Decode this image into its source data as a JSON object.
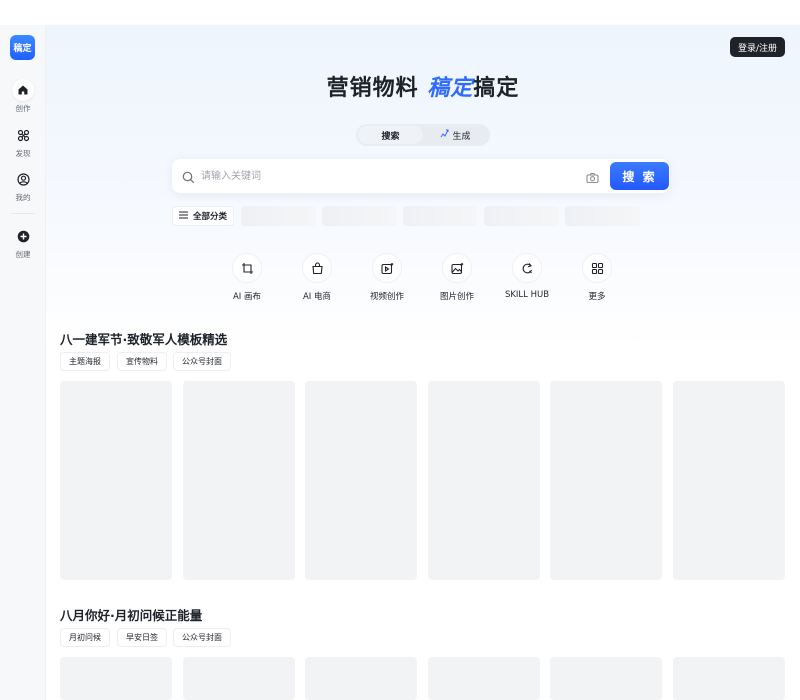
{
  "sidebar": {
    "logo_text": "稿定",
    "items": [
      {
        "label": "创作",
        "icon": "home-icon",
        "active": true
      },
      {
        "label": "发现",
        "icon": "discover-icon",
        "active": false
      },
      {
        "label": "我的",
        "icon": "user-icon",
        "active": false
      },
      {
        "label": "创建",
        "icon": "plus-circle-icon",
        "active": false
      }
    ]
  },
  "header": {
    "login_label": "登录/注册"
  },
  "hero": {
    "text_before": "营销物料 ",
    "text_accent": "稿定",
    "text_after": "搞定"
  },
  "mode_tabs": [
    {
      "label": "搜索",
      "active": true
    },
    {
      "label": "生成",
      "active": false
    }
  ],
  "search": {
    "placeholder": "请输入关键词",
    "button_label": "搜 索"
  },
  "categories": {
    "all_label": "全部分类"
  },
  "tools": [
    {
      "label": "AI 画布",
      "icon": "canvas-crop-icon"
    },
    {
      "label": "AI 电商",
      "icon": "shopping-bag-icon"
    },
    {
      "label": "视频创作",
      "icon": "video-sparkle-icon"
    },
    {
      "label": "图片创作",
      "icon": "image-sparkle-icon"
    },
    {
      "label": "SKILL HUB",
      "icon": "skill-hub-icon"
    },
    {
      "label": "更多",
      "icon": "grid-icon"
    }
  ],
  "sections": [
    {
      "title": "八一建军节·致敬军人模板精选",
      "chips": [
        "主题海报",
        "宣传物料",
        "公众号封面"
      ]
    },
    {
      "title": "八月你好·月初问候正能量",
      "chips": [
        "月初问候",
        "早安日签",
        "公众号封面"
      ]
    }
  ],
  "colors": {
    "accent": "#2f6bff",
    "dark": "#1f2329",
    "skeleton": "#f2f3f5"
  }
}
